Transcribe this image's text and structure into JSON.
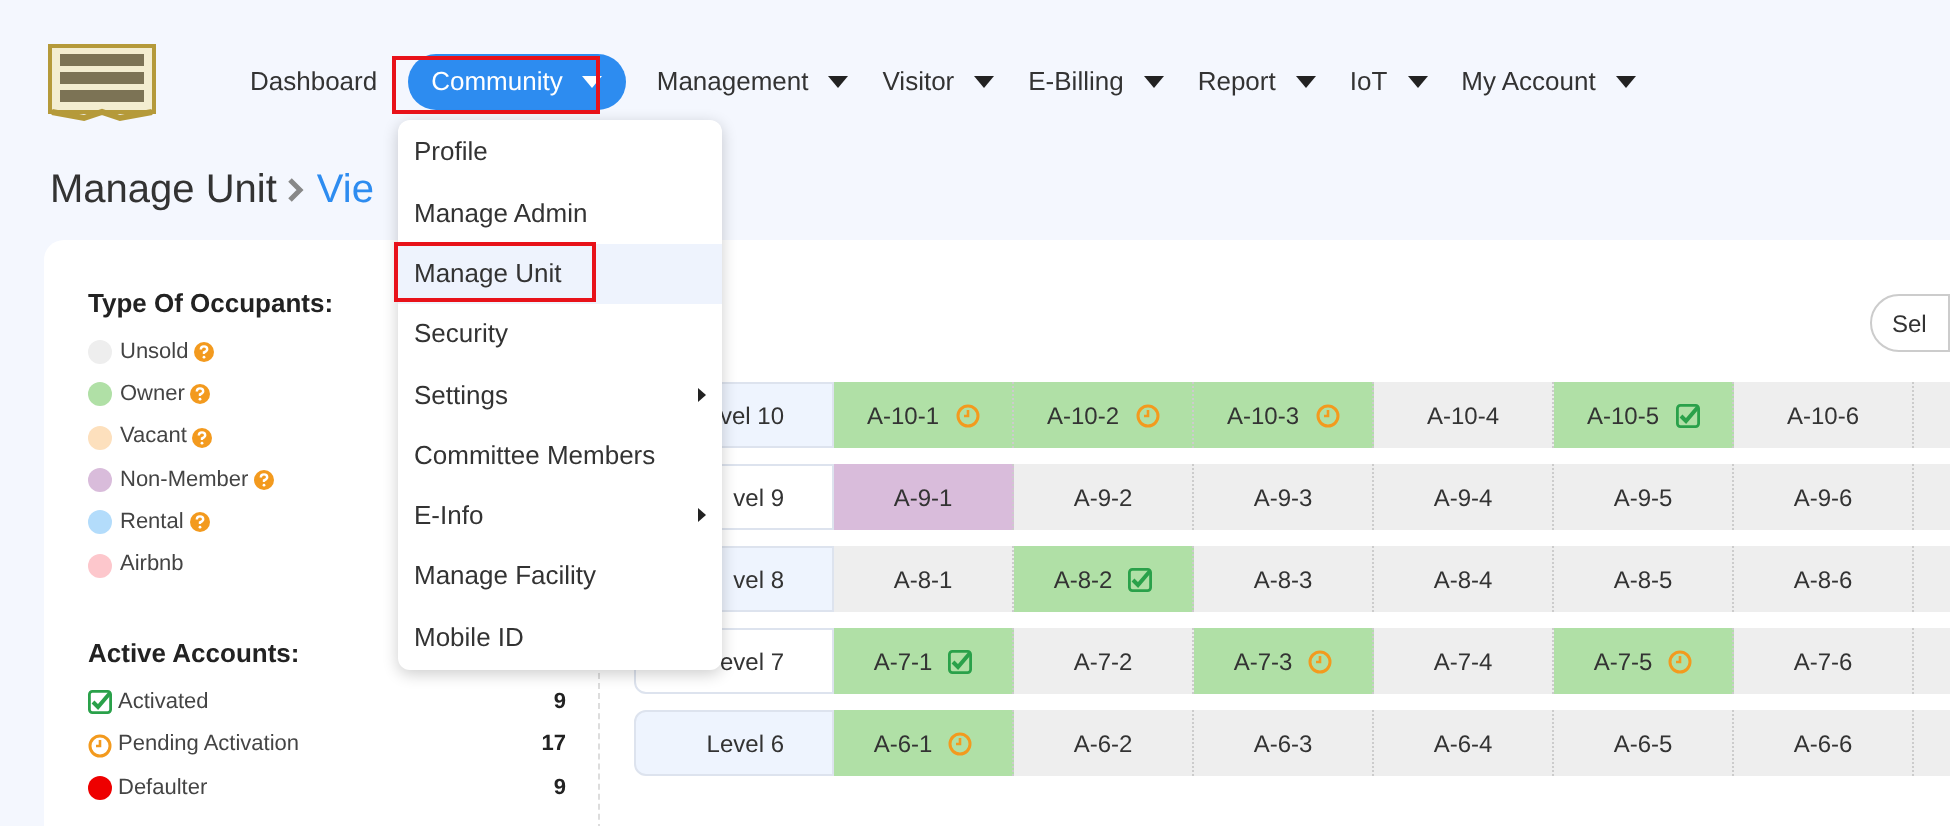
{
  "nav": [
    {
      "label": "Dashboard",
      "dropdown": false,
      "selected": false
    },
    {
      "label": "Community",
      "dropdown": true,
      "selected": true
    },
    {
      "label": "Management",
      "dropdown": true,
      "selected": false
    },
    {
      "label": "Visitor",
      "dropdown": true,
      "selected": false
    },
    {
      "label": "E-Billing",
      "dropdown": true,
      "selected": false
    },
    {
      "label": "Report",
      "dropdown": true,
      "selected": false
    },
    {
      "label": "IoT",
      "dropdown": true,
      "selected": false
    },
    {
      "label": "My Account",
      "dropdown": true,
      "selected": false
    }
  ],
  "breadcrumb": {
    "title": "Manage Unit",
    "current": "Vie"
  },
  "dropdown_menu": [
    {
      "label": "Profile",
      "selected": false,
      "submenu": false
    },
    {
      "label": "Manage Admin",
      "selected": false,
      "submenu": false
    },
    {
      "label": "Manage Unit",
      "selected": true,
      "submenu": false
    },
    {
      "label": "Security",
      "selected": false,
      "submenu": false
    },
    {
      "label": "Settings",
      "selected": false,
      "submenu": true
    },
    {
      "label": "Committee Members",
      "selected": false,
      "submenu": false
    },
    {
      "label": "E-Info",
      "selected": false,
      "submenu": true
    },
    {
      "label": "Manage Facility",
      "selected": false,
      "submenu": false
    },
    {
      "label": "Mobile ID",
      "selected": false,
      "submenu": false
    }
  ],
  "occupants": {
    "title": "Type Of Occupants:",
    "items": [
      {
        "label": "Unsold",
        "color": "#eeeeee",
        "help": true
      },
      {
        "label": "Owner",
        "color": "#b0e0a6",
        "help": true
      },
      {
        "label": "Vacant",
        "color": "#fde0bd",
        "help": true
      },
      {
        "label": "Non-Member",
        "color": "#d9bcdb",
        "help": true
      },
      {
        "label": "Rental",
        "color": "#b3dcfb",
        "help": true
      },
      {
        "label": "Airbnb",
        "color": "#fdc7cc",
        "help": false
      }
    ]
  },
  "accounts": {
    "title": "Active Accounts:",
    "items": [
      {
        "kind": "activated",
        "label": "Activated",
        "count": "9"
      },
      {
        "kind": "pending",
        "label": "Pending Activation",
        "count": "17"
      },
      {
        "kind": "defaulter",
        "label": "Defaulter",
        "count": "9"
      }
    ]
  },
  "select_button": "Sel",
  "levels": [
    {
      "label": "vel 10",
      "shaded": true,
      "units": [
        {
          "label": "A-10-1",
          "color": "#b0e0a6",
          "kind": "pending"
        },
        {
          "label": "A-10-2",
          "color": "#b0e0a6",
          "kind": "pending"
        },
        {
          "label": "A-10-3",
          "color": "#b0e0a6",
          "kind": "pending"
        },
        {
          "label": "A-10-4",
          "color": "#eeeeee",
          "kind": "plain"
        },
        {
          "label": "A-10-5",
          "color": "#b0e0a6",
          "kind": "activated"
        },
        {
          "label": "A-10-6",
          "color": "#eeeeee",
          "kind": "plain"
        }
      ]
    },
    {
      "label": "vel 9",
      "shaded": false,
      "units": [
        {
          "label": "A-9-1",
          "color": "#d9bcdb",
          "kind": "plain"
        },
        {
          "label": "A-9-2",
          "color": "#eeeeee",
          "kind": "plain"
        },
        {
          "label": "A-9-3",
          "color": "#eeeeee",
          "kind": "plain"
        },
        {
          "label": "A-9-4",
          "color": "#eeeeee",
          "kind": "plain"
        },
        {
          "label": "A-9-5",
          "color": "#eeeeee",
          "kind": "plain"
        },
        {
          "label": "A-9-6",
          "color": "#eeeeee",
          "kind": "plain"
        }
      ]
    },
    {
      "label": "vel 8",
      "shaded": true,
      "units": [
        {
          "label": "A-8-1",
          "color": "#eeeeee",
          "kind": "plain"
        },
        {
          "label": "A-8-2",
          "color": "#b0e0a6",
          "kind": "activated"
        },
        {
          "label": "A-8-3",
          "color": "#eeeeee",
          "kind": "plain"
        },
        {
          "label": "A-8-4",
          "color": "#eeeeee",
          "kind": "plain"
        },
        {
          "label": "A-8-5",
          "color": "#eeeeee",
          "kind": "plain"
        },
        {
          "label": "A-8-6",
          "color": "#eeeeee",
          "kind": "plain"
        }
      ]
    },
    {
      "label": "evel 7",
      "shaded": false,
      "units": [
        {
          "label": "A-7-1",
          "color": "#b0e0a6",
          "kind": "activated"
        },
        {
          "label": "A-7-2",
          "color": "#eeeeee",
          "kind": "plain"
        },
        {
          "label": "A-7-3",
          "color": "#b0e0a6",
          "kind": "pending"
        },
        {
          "label": "A-7-4",
          "color": "#eeeeee",
          "kind": "plain"
        },
        {
          "label": "A-7-5",
          "color": "#b0e0a6",
          "kind": "pending"
        },
        {
          "label": "A-7-6",
          "color": "#eeeeee",
          "kind": "plain"
        }
      ]
    },
    {
      "label": "Level 6",
      "shaded": true,
      "units": [
        {
          "label": "A-6-1",
          "color": "#b0e0a6",
          "kind": "pending"
        },
        {
          "label": "A-6-2",
          "color": "#eeeeee",
          "kind": "plain"
        },
        {
          "label": "A-6-3",
          "color": "#eeeeee",
          "kind": "plain"
        },
        {
          "label": "A-6-4",
          "color": "#eeeeee",
          "kind": "plain"
        },
        {
          "label": "A-6-5",
          "color": "#eeeeee",
          "kind": "plain"
        },
        {
          "label": "A-6-6",
          "color": "#eeeeee",
          "kind": "plain"
        }
      ]
    }
  ]
}
